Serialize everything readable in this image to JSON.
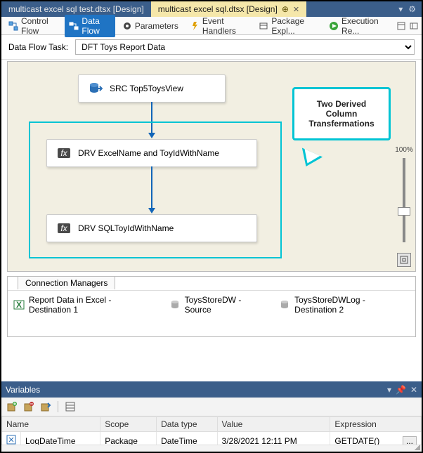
{
  "doc_tabs": {
    "inactive": "multicast excel sql test.dtsx [Design]",
    "active": "multicast excel sql.dtsx [Design]"
  },
  "nav": {
    "control_flow": "Control Flow",
    "data_flow": "Data Flow",
    "parameters": "Parameters",
    "event_handlers": "Event Handlers",
    "package_explorer": "Package Expl...",
    "execution": "Execution Re..."
  },
  "task_row": {
    "label": "Data Flow Task:",
    "value": "DFT Toys Report Data"
  },
  "canvas": {
    "node_src": "SRC Top5ToysView",
    "node_drv1": "DRV ExcelName and ToyIdWithName",
    "node_drv2": "DRV SQLToyIdWithName",
    "callout_line1": "Two Derived",
    "callout_line2": "Column",
    "callout_line3": "Transfermations",
    "zoom_label": "100%"
  },
  "conn_mgr": {
    "tab": "Connection Managers",
    "item1": "Report Data in Excel  - Destination 1",
    "item2": "ToysStoreDW - Source",
    "item3": "ToysStoreDWLog - Destination 2"
  },
  "variables": {
    "title": "Variables",
    "cols": {
      "name": "Name",
      "scope": "Scope",
      "dtype": "Data type",
      "value": "Value",
      "expr": "Expression"
    },
    "row": {
      "name": "LogDateTime",
      "scope": "Package",
      "dtype": "DateTime",
      "value": "3/28/2021 12:11 PM",
      "expr": "GETDATE()"
    }
  }
}
